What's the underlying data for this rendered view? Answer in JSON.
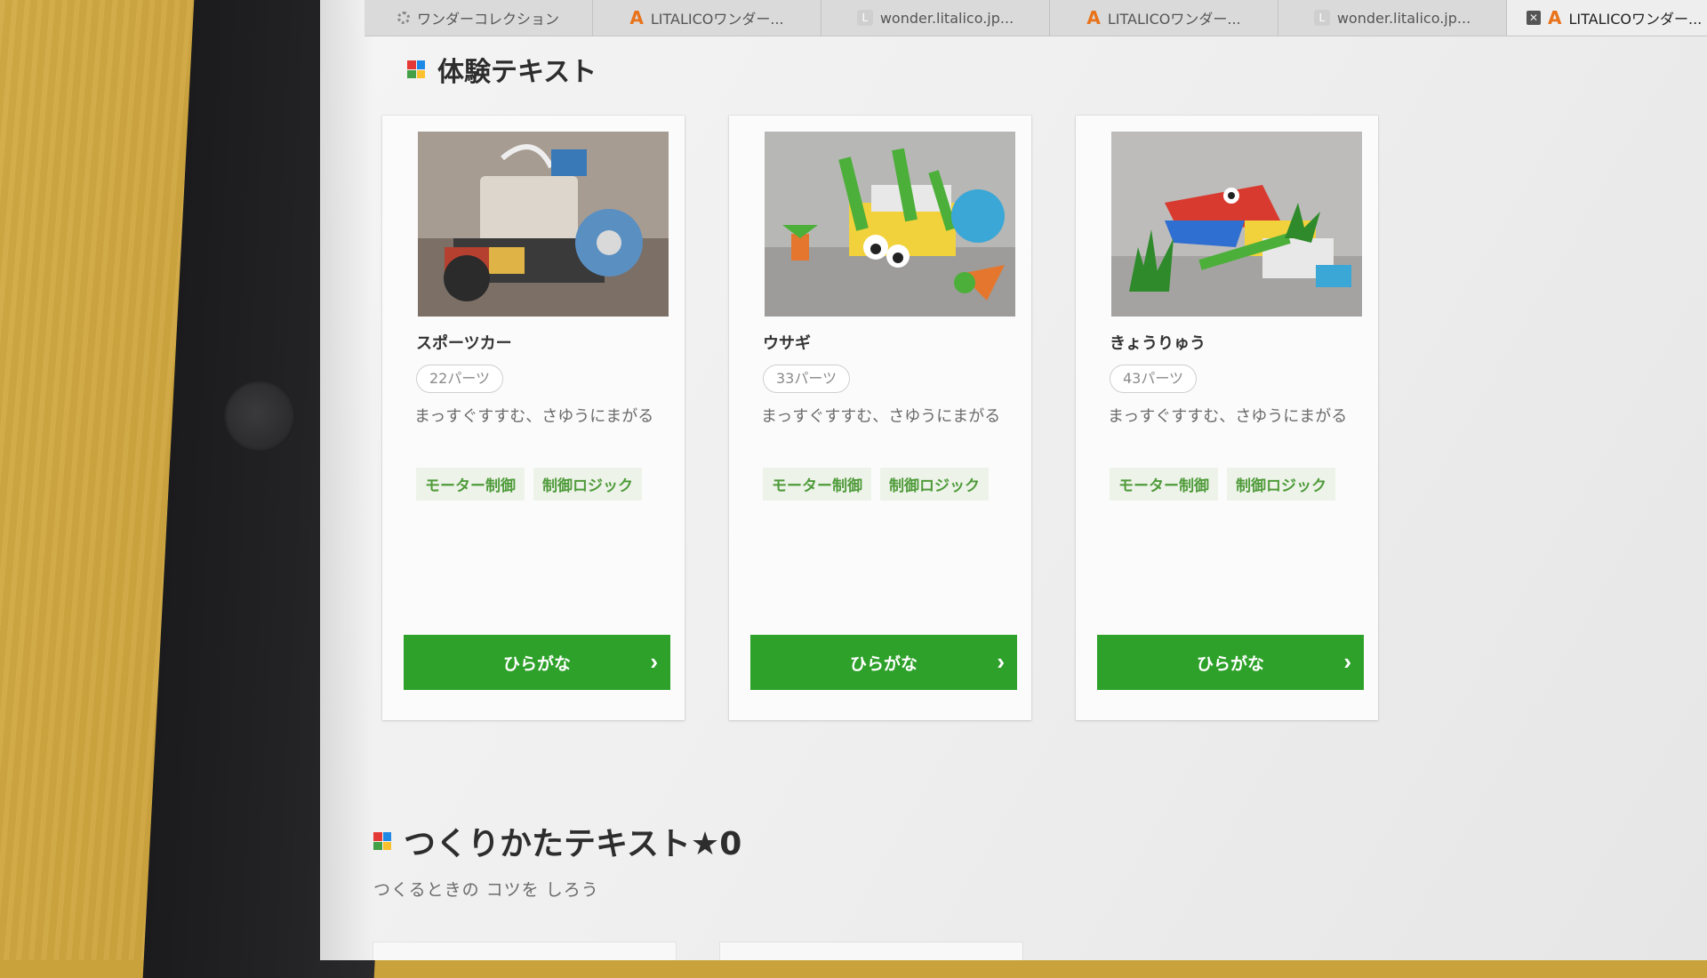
{
  "tabs": [
    {
      "label": "ワンダーコレクション",
      "icon": "loading-icon",
      "active": false
    },
    {
      "label": "LITALICOワンダー...",
      "icon": "litalico-a-icon",
      "active": false
    },
    {
      "label": "wonder.litalico.jp...",
      "icon": "page-l-icon",
      "active": false
    },
    {
      "label": "LITALICOワンダー...",
      "icon": "litalico-a-icon",
      "active": false
    },
    {
      "label": "wonder.litalico.jp...",
      "icon": "page-l-icon",
      "active": false
    },
    {
      "label": "LITALICOワンダー...",
      "icon": "litalico-a-icon",
      "active": true
    }
  ],
  "tab_close_symbol": "✕",
  "favicon_a": "A",
  "favicon_l": "L",
  "section1": {
    "title": "体験テキスト"
  },
  "cards": [
    {
      "title": "スポーツカー",
      "parts": "22パーツ",
      "description": "まっすぐすすむ、さゆうにまがる",
      "tags": [
        "モーター制御",
        "制御ロジック"
      ],
      "button": "ひらがな",
      "image": "sports-car-lego-model"
    },
    {
      "title": "ウサギ",
      "parts": "33パーツ",
      "description": "まっすぐすすむ、さゆうにまがる",
      "tags": [
        "モーター制御",
        "制御ロジック"
      ],
      "button": "ひらがな",
      "image": "rabbit-lego-model"
    },
    {
      "title": "きょうりゅう",
      "parts": "43パーツ",
      "description": "まっすぐすすむ、さゆうにまがる",
      "tags": [
        "モーター制御",
        "制御ロジック"
      ],
      "button": "ひらがな",
      "image": "dinosaur-lego-model"
    }
  ],
  "button_chevron": "›",
  "section2": {
    "title": "つくりかたテキスト★0",
    "subtitle": "つくるときの コツを しろう"
  },
  "colors": {
    "accent_green": "#2ea12a",
    "tag_green": "#4f9b3a",
    "logo": [
      "#e53935",
      "#1e88e5",
      "#43a047",
      "#fbc02d"
    ]
  }
}
